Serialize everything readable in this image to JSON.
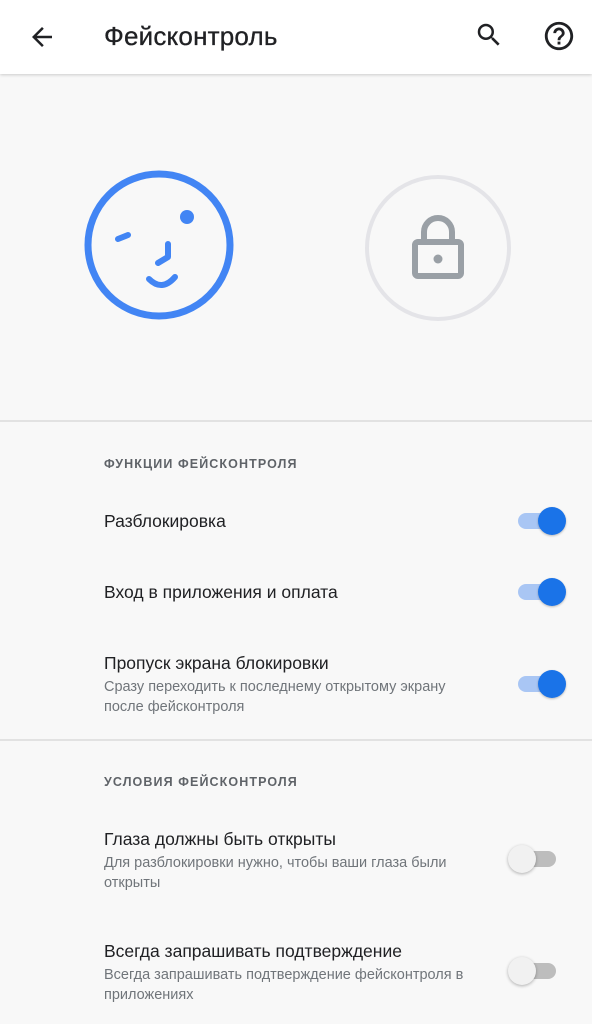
{
  "appbar": {
    "title": "Фейсконтроль",
    "back_icon": "arrow-back-icon",
    "search_icon": "search-icon",
    "help_icon": "help-circle-icon"
  },
  "hero": {
    "face_icon": "face-icon",
    "lock_icon": "lock-icon",
    "accent_color": "#4285f4",
    "lock_color": "#9aa0a6"
  },
  "features": {
    "header": "ФУНКЦИИ ФЕЙСКОНТРОЛЯ",
    "items": [
      {
        "title": "Разблокировка",
        "subtitle": "",
        "enabled": true
      },
      {
        "title": "Вход в приложения и оплата",
        "subtitle": "",
        "enabled": true
      },
      {
        "title": "Пропуск экрана блокировки",
        "subtitle": "Сразу переходить к последнему открытому экрану после фейсконтроля",
        "enabled": true
      }
    ]
  },
  "conditions": {
    "header": "УСЛОВИЯ ФЕЙСКОНТРОЛЯ",
    "items": [
      {
        "title": "Глаза должны быть открыты",
        "subtitle": "Для разблокировки нужно, чтобы ваши глаза были открыты",
        "enabled": false
      },
      {
        "title": "Всегда запрашивать подтверждение",
        "subtitle": "Всегда запрашивать подтверждение фейсконтроля в приложениях",
        "enabled": false
      }
    ]
  },
  "colors": {
    "switch_on_thumb": "#1a73e8",
    "switch_on_track": "#a9c6f4",
    "switch_off_thumb": "#f1f1f1",
    "switch_off_track": "#bdbdbd"
  }
}
